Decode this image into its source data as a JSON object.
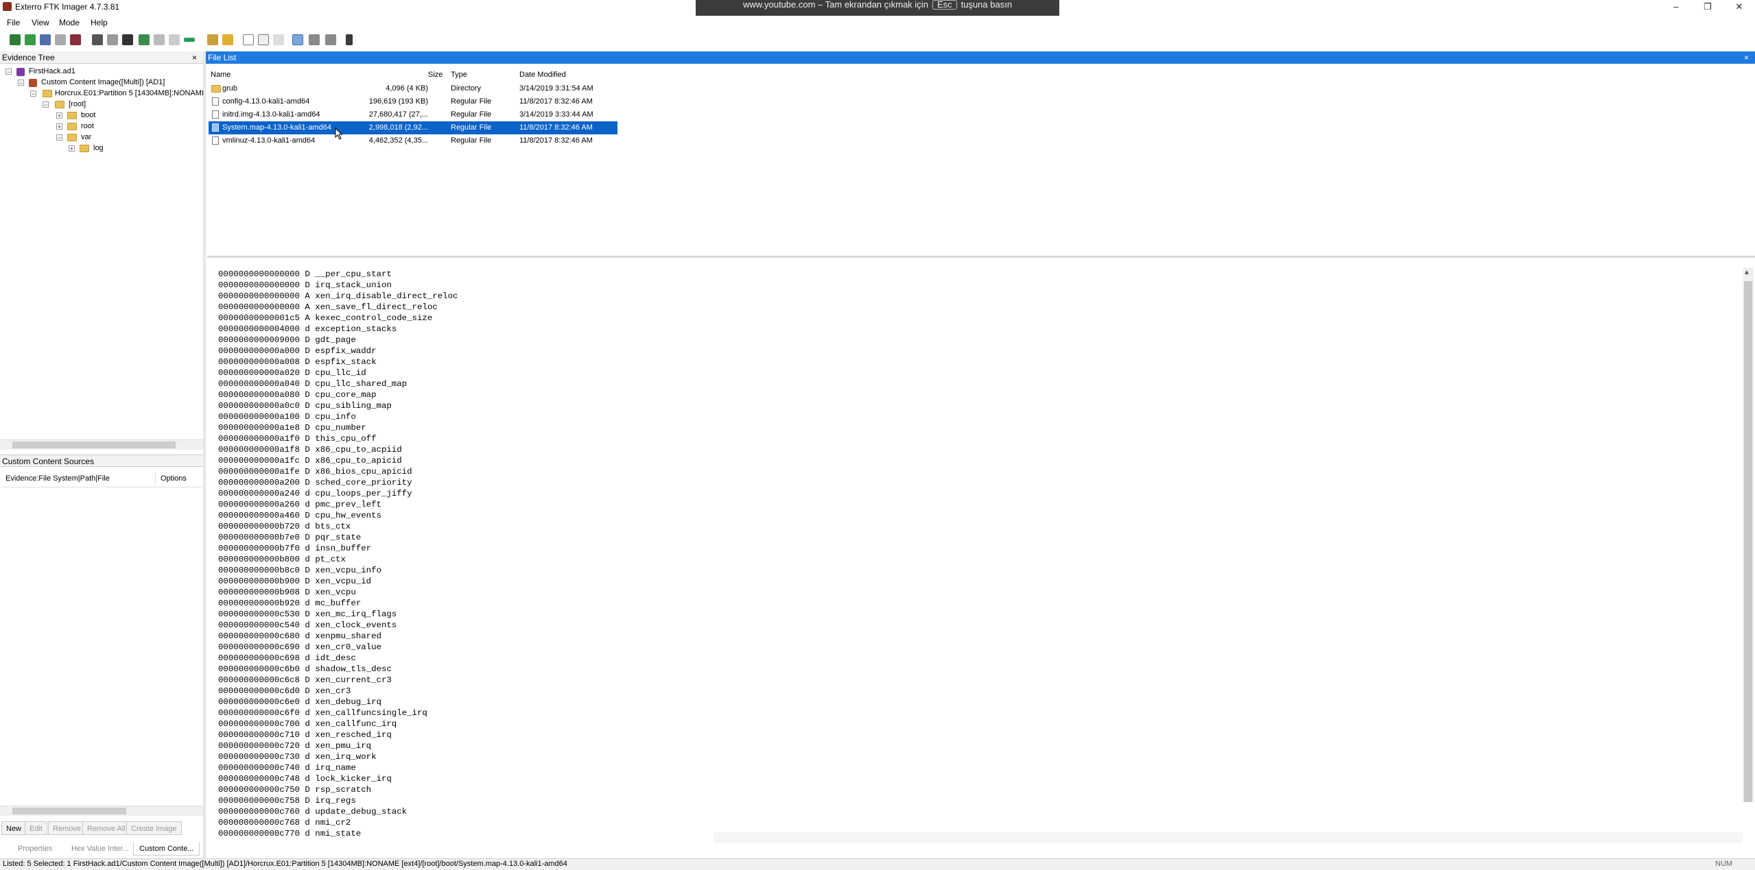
{
  "window": {
    "title": "Exterro FTK Imager 4.7.3.81",
    "minimize": "–",
    "restore": "❐",
    "close": "✕"
  },
  "fullscreen_notice": {
    "text_before": "www.youtube.com – Tam ekrandan çıkmak için",
    "key": "Esc",
    "text_after": "tuşuna basın"
  },
  "menu": [
    "File",
    "View",
    "Mode",
    "Help"
  ],
  "evidence_tree": {
    "header": "Evidence Tree",
    "close": "×",
    "items": [
      {
        "label": "FirstHack.ad1",
        "toggle": "−"
      },
      {
        "label": "Custom Content Image([Multi]) [AD1]",
        "toggle": "−"
      },
      {
        "label": "Horcrux.E01:Partition 5 [14304MB]:NONAME [ext4]",
        "toggle": "−"
      },
      {
        "label": "[root]",
        "toggle": "−"
      },
      {
        "label": "boot",
        "toggle": "+"
      },
      {
        "label": "root",
        "toggle": "+"
      },
      {
        "label": "var",
        "toggle": "−"
      },
      {
        "label": "log",
        "toggle": "+"
      }
    ]
  },
  "custom_content": {
    "header": "Custom Content Sources",
    "col_evidence": "Evidence:File System|Path|File",
    "col_options": "Options",
    "buttons": [
      "New",
      "Edit",
      "Remove",
      "Remove All",
      "Create Image"
    ],
    "tabs": [
      "Properties",
      "Hex Value Inter...",
      "Custom Conte..."
    ]
  },
  "file_list": {
    "header": "File List",
    "close": "×",
    "columns": {
      "name": "Name",
      "size": "Size",
      "type": "Type",
      "date": "Date Modified"
    },
    "rows": [
      {
        "name": "grub",
        "size": "4,096 (4 KB)",
        "type": "Directory",
        "date": "3/14/2019 3:31:54 AM"
      },
      {
        "name": "config-4.13.0-kali1-amd64",
        "size": "196,619 (193 KB)",
        "type": "Regular File",
        "date": "11/8/2017 8:32:46 AM"
      },
      {
        "name": "initrd.img-4.13.0-kali1-amd64",
        "size": "27,680,417 (27,...",
        "type": "Regular File",
        "date": "3/14/2019 3:33:44 AM"
      },
      {
        "name": "System.map-4.13.0-kali1-amd64",
        "size": "2,998,018 (2,92...",
        "type": "Regular File",
        "date": "11/8/2017 8:32:46 AM"
      },
      {
        "name": "vmlinuz-4.13.0-kali1-amd64",
        "size": "4,462,352 (4,35...",
        "type": "Regular File",
        "date": "11/8/2017 8:32:46 AM"
      }
    ]
  },
  "viewer_lines": [
    "0000000000000000 D __per_cpu_start",
    "0000000000000000 D irq_stack_union",
    "0000000000000000 A xen_irq_disable_direct_reloc",
    "0000000000000000 A xen_save_fl_direct_reloc",
    "00000000000001c5 A kexec_control_code_size",
    "0000000000004000 d exception_stacks",
    "0000000000009000 D gdt_page",
    "000000000000a000 D espfix_waddr",
    "000000000000a008 D espfix_stack",
    "000000000000a020 D cpu_llc_id",
    "000000000000a040 D cpu_llc_shared_map",
    "000000000000a080 D cpu_core_map",
    "000000000000a0c0 D cpu_sibling_map",
    "000000000000a100 D cpu_info",
    "000000000000a1e8 D cpu_number",
    "000000000000a1f0 D this_cpu_off",
    "000000000000a1f8 D x86_cpu_to_acpiid",
    "000000000000a1fc D x86_cpu_to_apicid",
    "000000000000a1fe D x86_bios_cpu_apicid",
    "000000000000a200 D sched_core_priority",
    "000000000000a240 d cpu_loops_per_jiffy",
    "000000000000a260 d pmc_prev_left",
    "000000000000a460 D cpu_hw_events",
    "000000000000b720 d bts_ctx",
    "000000000000b7e0 D pqr_state",
    "000000000000b7f0 d insn_buffer",
    "000000000000b800 d pt_ctx",
    "000000000000b8c0 D xen_vcpu_info",
    "000000000000b900 D xen_vcpu_id",
    "000000000000b908 D xen_vcpu",
    "000000000000b920 d mc_buffer",
    "000000000000c530 D xen_mc_irq_flags",
    "000000000000c540 d xen_clock_events",
    "000000000000c680 d xenpmu_shared",
    "000000000000c690 d xen_cr0_value",
    "000000000000c698 d idt_desc",
    "000000000000c6b0 d shadow_tls_desc",
    "000000000000c6c8 D xen_current_cr3",
    "000000000000c6d0 D xen_cr3",
    "000000000000c6e0 d xen_debug_irq",
    "000000000000c6f0 d xen_callfuncsingle_irq",
    "000000000000c700 d xen_callfunc_irq",
    "000000000000c710 d xen_resched_irq",
    "000000000000c720 d xen_pmu_irq",
    "000000000000c730 d xen_irq_work",
    "000000000000c740 d irq_name",
    "000000000000c748 d lock_kicker_irq",
    "000000000000c750 D rsp_scratch",
    "000000000000c758 D irq_regs",
    "000000000000c760 d update_debug_stack",
    "000000000000c768 d nmi_cr2",
    "000000000000c770 d nmi_state"
  ],
  "status_bar": {
    "text": "Listed: 5   Selected: 1   FirstHack.ad1/Custom Content Image([Multi]) [AD1]/Horcrux.E01:Partition 5 [14304MB]:NONAME [ext4]/[root]/boot/System.map-4.13.0-kali1-amd64",
    "num": "NUM"
  }
}
